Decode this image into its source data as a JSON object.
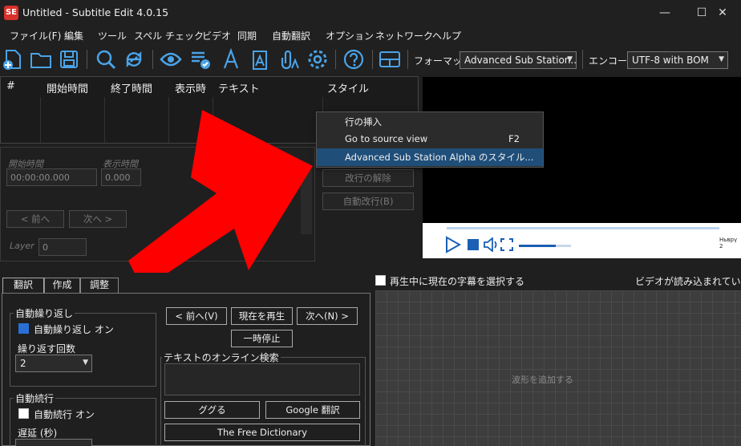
{
  "window": {
    "title": "Untitled - Subtitle Edit 4.0.15",
    "icon_text": "SE",
    "minimize": "—",
    "maximize": "☐",
    "close": "✕"
  },
  "menu": [
    "ファイル(F)",
    "編集",
    "ツール",
    "スペル チェック",
    "ビデオ",
    "同期",
    "自動翻訳",
    "オプション",
    "ネットワーク",
    "ヘルプ"
  ],
  "toolbar": {
    "format_label": "フォーマット",
    "format_value": "Advanced Sub Station...",
    "encoding_label": "エンコード",
    "encoding_value": "UTF-8 with BOM"
  },
  "grid": {
    "headers": [
      "#",
      "開始時間",
      "終了時間",
      "表示時",
      "テキスト",
      "スタイル"
    ]
  },
  "edit": {
    "start_label": "開始時間",
    "start_value": "00:00:00.000",
    "duration_label": "表示時間",
    "duration_value": "0.000",
    "prev": "< 前へ",
    "next": "次へ >",
    "layer_label": "Layer",
    "layer_value": "0",
    "unbreak": "改行の解除",
    "auto_break": "自動改行(B)"
  },
  "context_menu": {
    "items": [
      "行の挿入",
      "Go to source view",
      "Advanced Sub Station Alpha のスタイル..."
    ],
    "shortcut": "F2"
  },
  "video": {
    "time_text": "Ньврү 2"
  },
  "tabs": [
    "翻訳",
    "作成",
    "調整"
  ],
  "translate": {
    "auto_repeat_group": "自動繰り返し",
    "auto_repeat_on": "自動繰り返し オン",
    "repeat_count_label": "繰り返す回数",
    "repeat_count_value": "2",
    "auto_continue_group": "自動続行",
    "auto_continue_on": "自動続行 オン",
    "delay_label": "遅延 (秒)",
    "prev_btn": "< 前へ(V)",
    "play_current_btn": "現在を再生",
    "next_btn": "次へ(N) >",
    "pause_btn": "一時停止",
    "search_group": "テキストのオンライン検索",
    "google_btn": "ググる",
    "google_translate_btn": "Google 翻訳",
    "free_dict_btn": "The Free Dictionary"
  },
  "waveform": {
    "select_current": "再生中に現在の字幕を選択する",
    "no_video": "ビデオが読み込まれていません",
    "add_waveform": "波形を追加する"
  },
  "colors": {
    "arrow": "#ff0000",
    "menu_highlight": "#1f4e79",
    "accent": "#2a6fd6"
  }
}
